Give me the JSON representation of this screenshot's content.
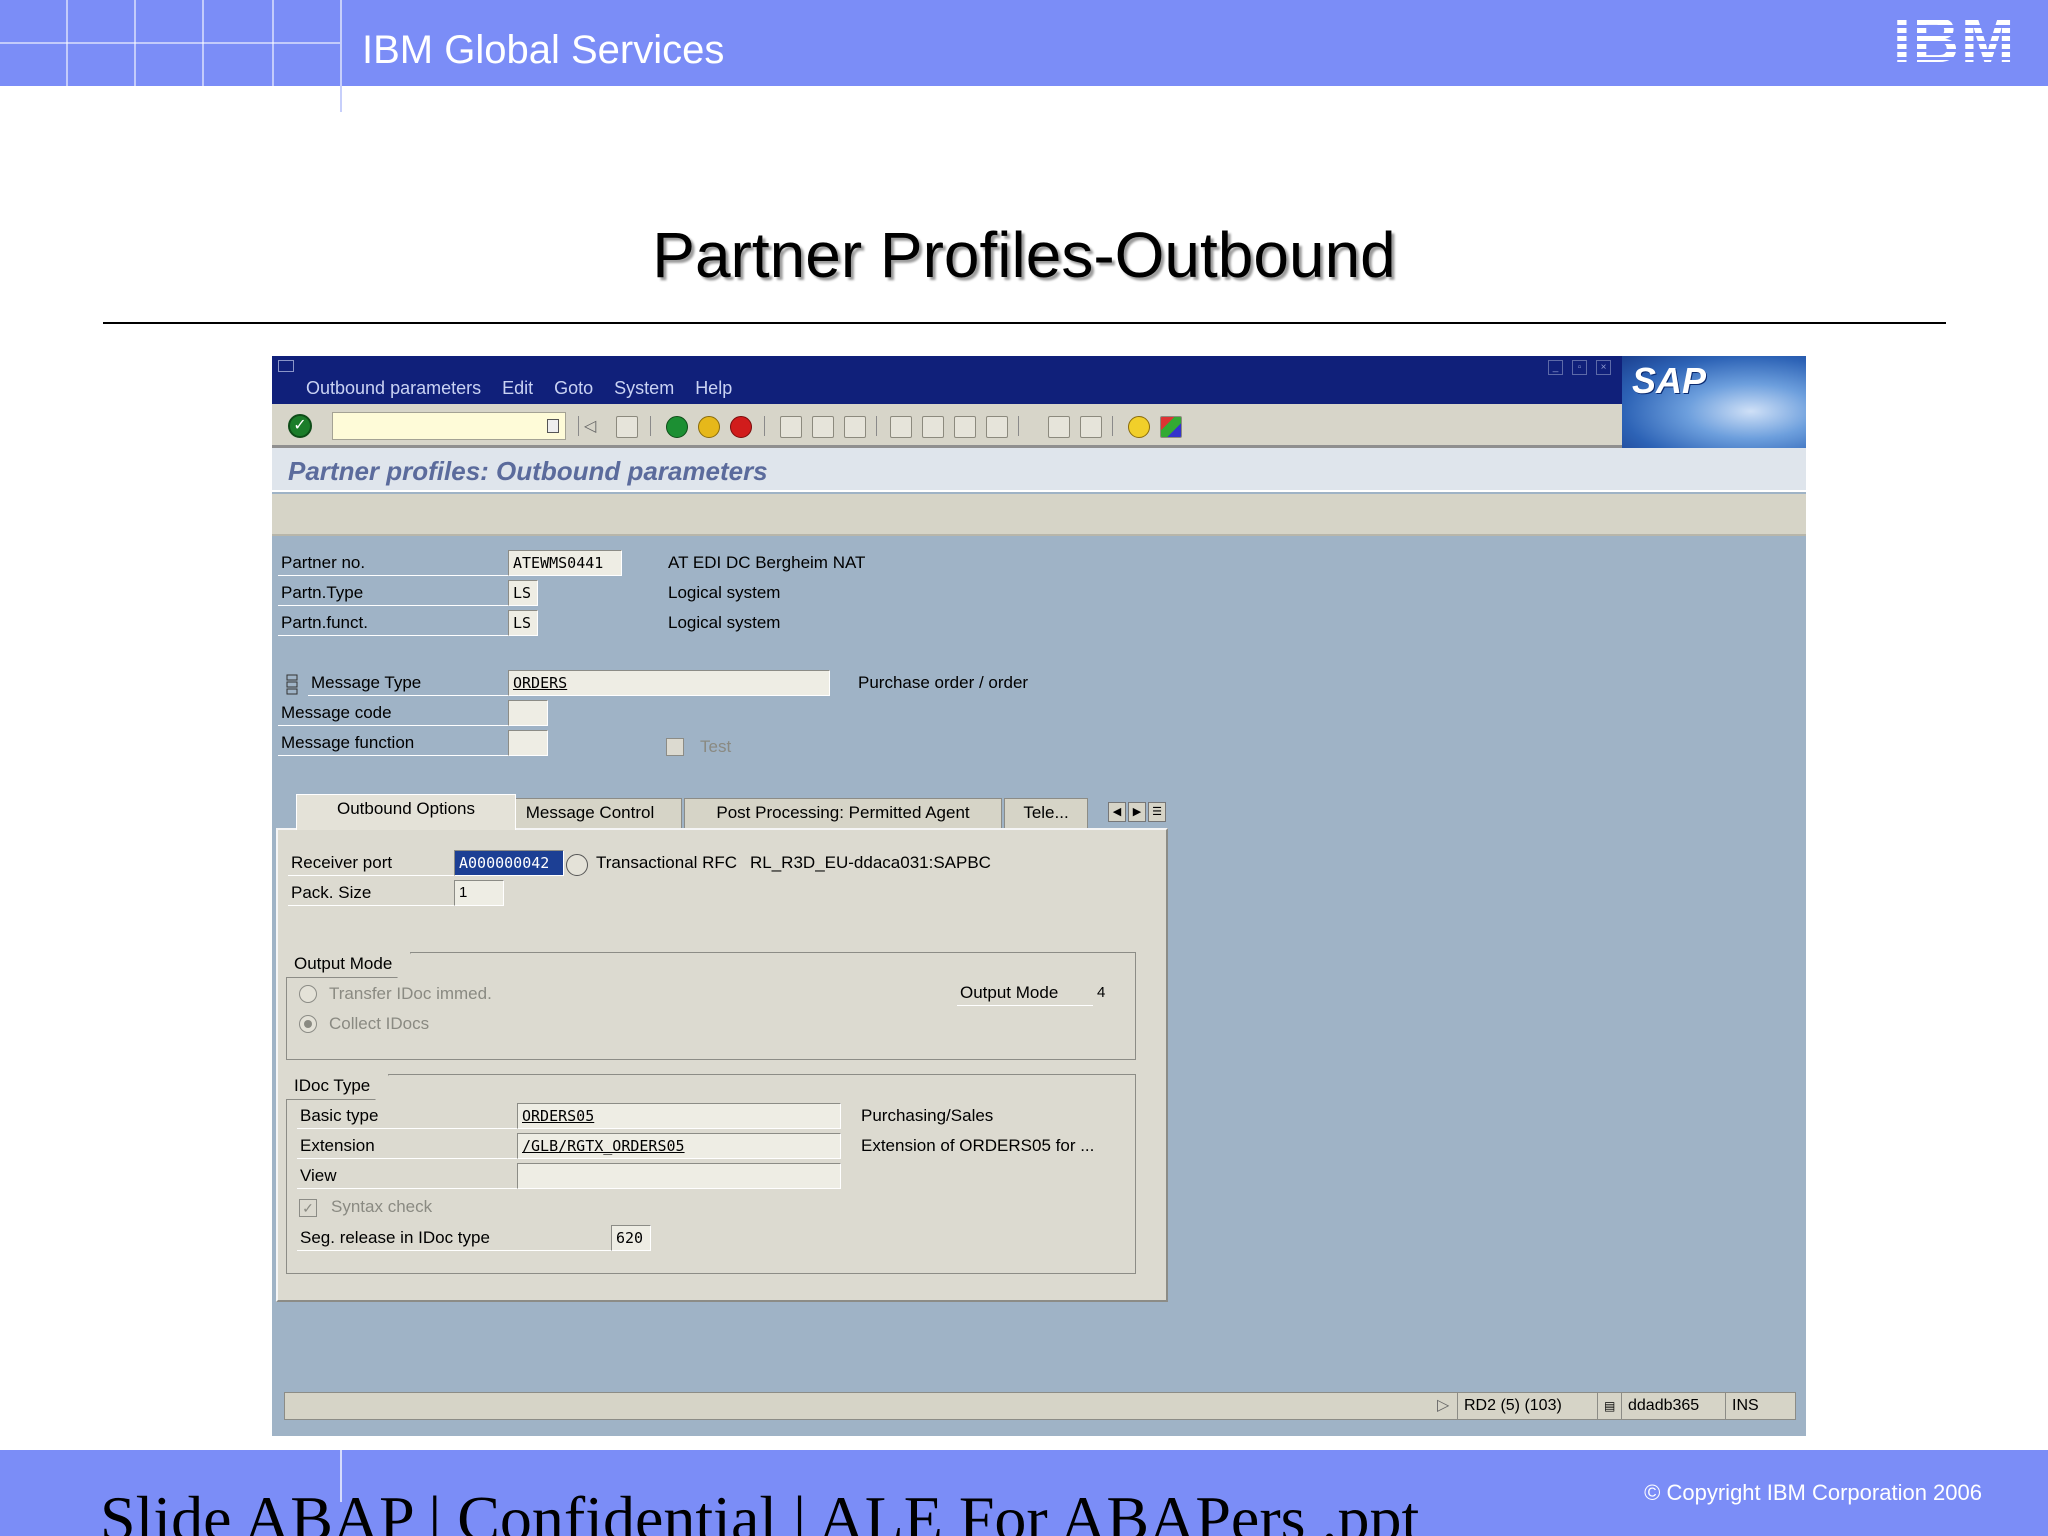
{
  "header": {
    "org": "IBM Global Services",
    "logo_text": "IBM"
  },
  "slide": {
    "title": "Partner Profiles-Outbound"
  },
  "sap": {
    "menu": [
      "Outbound parameters",
      "Edit",
      "Goto",
      "System",
      "Help"
    ],
    "logo": "SAP",
    "screen_title": "Partner profiles: Outbound parameters",
    "partner_no_label": "Partner no.",
    "partner_no_value": "ATEWMS0441",
    "partner_no_desc": "AT EDI DC Bergheim NAT",
    "partn_type_label": "Partn.Type",
    "partn_type_value": "LS",
    "partn_type_desc": "Logical system",
    "partn_funct_label": "Partn.funct.",
    "partn_funct_value": "LS",
    "partn_funct_desc": "Logical system",
    "message_type_label": "Message Type",
    "message_type_value": "ORDERS",
    "message_type_desc": "Purchase order / order",
    "message_code_label": "Message code",
    "message_function_label": "Message function",
    "test_label": "Test",
    "tabs": [
      "Outbound Options",
      "Message Control",
      "Post Processing: Permitted Agent",
      "Tele..."
    ],
    "receiver_port_label": "Receiver port",
    "receiver_port_value": "A000000042",
    "receiver_port_type": "Transactional RFC",
    "receiver_port_desc": "RL_R3D_EU-ddaca031:SAPBC",
    "pack_size_label": "Pack. Size",
    "pack_size_value": "1",
    "output_mode_group": "Output Mode",
    "transfer_idoc_label": "Transfer IDoc immed.",
    "collect_idocs_label": "Collect IDocs",
    "output_mode_label": "Output Mode",
    "output_mode_value": "4",
    "idoc_type_group": "IDoc Type",
    "basic_type_label": "Basic type",
    "basic_type_value": "ORDERS05",
    "basic_type_desc": "Purchasing/Sales",
    "extension_label": "Extension",
    "extension_value": "/GLB/RGTX_ORDERS05",
    "extension_desc": "Extension of ORDERS05 for ...",
    "view_label": "View",
    "syntax_check_label": "Syntax check",
    "seg_release_label": "Seg. release in IDoc type",
    "seg_release_value": "620",
    "status": {
      "system": "RD2 (5) (103)",
      "server": "ddadb365",
      "mode": "INS"
    }
  },
  "footer": {
    "text": "Slide        ABAP | Confidential  |   ALE For ABAPers .ppt",
    "copyright": "© Copyright IBM Corporation 2006"
  }
}
